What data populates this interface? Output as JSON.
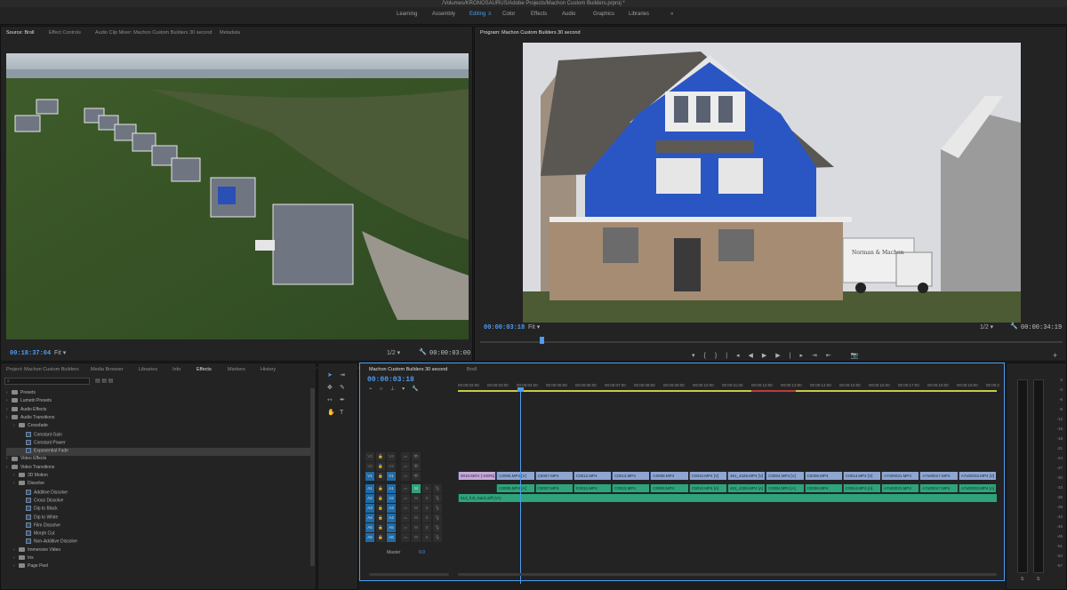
{
  "window": {
    "title": "/Volumes/KRONOSAURUS/Adobe Projects/Machon Custom Builders.prproj *"
  },
  "workspaces": [
    {
      "label": "Learning",
      "active": false
    },
    {
      "label": "Assembly",
      "active": false
    },
    {
      "label": "Editing",
      "active": true
    },
    {
      "label": "Color",
      "active": false
    },
    {
      "label": "Effects",
      "active": false
    },
    {
      "label": "Audio",
      "active": false
    },
    {
      "label": "Graphics",
      "active": false
    },
    {
      "label": "Libraries",
      "active": false
    }
  ],
  "workspaces_more": "»",
  "source": {
    "tabs": [
      "Source: Broll",
      "Effect Controls",
      "Audio Clip Mixer: Machon Custom Builders 30 second",
      "Metadata"
    ],
    "timecode": "00:18:37:04",
    "fit": "Fit",
    "resolution": "1/2",
    "duration": "00:00:03:00"
  },
  "program": {
    "tab": "Program: Machon Custom Builders 30 second",
    "timecode": "00:00:03:18",
    "fit": "Fit",
    "resolution": "1/2",
    "duration": "00:00:34:19",
    "truck_sign": "Norman & Machon"
  },
  "project": {
    "tabs": [
      "Project: Machon Custom Builders",
      "Media Browser",
      "Libraries",
      "Info",
      "Effects",
      "Markers",
      "History"
    ],
    "search_placeholder": "",
    "tree": [
      {
        "label": "Presets",
        "level": 0,
        "type": "folder",
        "sel": false
      },
      {
        "label": "Lumetri Presets",
        "level": 0,
        "type": "folder",
        "sel": false
      },
      {
        "label": "Audio Effects",
        "level": 0,
        "type": "folder",
        "sel": false
      },
      {
        "label": "Audio Transitions",
        "level": 0,
        "type": "folder",
        "sel": false
      },
      {
        "label": "Crossfade",
        "level": 1,
        "type": "folder",
        "sel": false
      },
      {
        "label": "Constant Gain",
        "level": 2,
        "type": "fx",
        "sel": false
      },
      {
        "label": "Constant Power",
        "level": 2,
        "type": "fx",
        "sel": false
      },
      {
        "label": "Exponential Fade",
        "level": 2,
        "type": "fx",
        "sel": true
      },
      {
        "label": "Video Effects",
        "level": 0,
        "type": "folder",
        "sel": false
      },
      {
        "label": "Video Transitions",
        "level": 0,
        "type": "folder",
        "sel": false
      },
      {
        "label": "3D Motion",
        "level": 1,
        "type": "folder",
        "sel": false
      },
      {
        "label": "Dissolve",
        "level": 1,
        "type": "folder",
        "sel": false
      },
      {
        "label": "Additive Dissolve",
        "level": 2,
        "type": "fx",
        "sel": false
      },
      {
        "label": "Cross Dissolve",
        "level": 2,
        "type": "fx",
        "sel": false
      },
      {
        "label": "Dip to Black",
        "level": 2,
        "type": "fx",
        "sel": false
      },
      {
        "label": "Dip to White",
        "level": 2,
        "type": "fx",
        "sel": false
      },
      {
        "label": "Film Dissolve",
        "level": 2,
        "type": "fx",
        "sel": false
      },
      {
        "label": "Morph Cut",
        "level": 2,
        "type": "fx",
        "sel": false
      },
      {
        "label": "Non-Additive Dissolve",
        "level": 2,
        "type": "fx",
        "sel": false
      },
      {
        "label": "Immersive Video",
        "level": 1,
        "type": "folder",
        "sel": false
      },
      {
        "label": "Iris",
        "level": 1,
        "type": "folder",
        "sel": false
      },
      {
        "label": "Page Peel",
        "level": 1,
        "type": "folder",
        "sel": false
      }
    ]
  },
  "timeline": {
    "tabs": [
      "Machon Custom Builders 30 second",
      "Broll"
    ],
    "timecode": "00:00:03:18",
    "ruler": [
      "00:00:02:00",
      "00:00:03:00",
      "00:00:04:00",
      "00:00:05:00",
      "00:00:06:00",
      "00:00:07:00",
      "00:00:08:00",
      "00:00:09:00",
      "00:00:10:00",
      "00:00:11:00",
      "00:00:12:00",
      "00:00:13:00",
      "00:00:14:00",
      "00:00:15:00",
      "00:00:16:00",
      "00:00:17:00",
      "00:00:18:00",
      "00:00:19:00",
      "00:00:2"
    ],
    "tracks": [
      {
        "name": "V3",
        "type": "video"
      },
      {
        "name": "V2",
        "type": "video"
      },
      {
        "name": "V1",
        "type": "video"
      },
      {
        "name": "A1",
        "type": "audio"
      },
      {
        "name": "A2",
        "type": "audio"
      },
      {
        "name": "A3",
        "type": "audio"
      },
      {
        "name": "A4",
        "type": "audio"
      },
      {
        "name": "A5",
        "type": "audio"
      },
      {
        "name": "A6",
        "type": "audio"
      }
    ],
    "master_label": "Master",
    "master_value": "0.0",
    "v1_clips": [
      "0010.MOV [-100%]",
      "C0005.MP4 [V]",
      "C0007.MP4",
      "C0012.MP4",
      "C0013.MP4",
      "C0008.MP4",
      "C0010.MP4 [V]",
      "461_4325.MP4 [V]",
      "C0004.MP4 [V]",
      "C0006.MP4",
      "C0014.MP4 [V]",
      "A7x00031.MP4",
      "A7x00017.MP4",
      "A7x00033.MP4 [V]"
    ],
    "a1_clips": [
      "C0005.MP4 [A]",
      "C0007.MP4",
      "C0012.MP4",
      "C0013.MP4",
      "C0008.MP4",
      "C0010.MP4 [A]",
      "461_4325.MP4 [A]",
      "C0004.MP4 [A]",
      "C0006.MP4",
      "C0014.MP4 [A]",
      "A7x00031.MP4",
      "A7x00017.MP4",
      "A7x00033.MP4 [A]"
    ],
    "a2_clip": "513_full_stack.aiff (V1)"
  },
  "meter": {
    "ticks": [
      "0",
      "-3",
      "-6",
      "-9",
      "-12",
      "-15",
      "-18",
      "-21",
      "-24",
      "-27",
      "-30",
      "-33",
      "-36",
      "-39",
      "-42",
      "-45",
      "-48",
      "-51",
      "-54",
      "-57"
    ],
    "solo": [
      "S",
      "S"
    ]
  },
  "colors": {
    "accent": "#4d9cf0",
    "video_clip": "#8fa6d2",
    "audio_clip": "#2fa37c"
  }
}
